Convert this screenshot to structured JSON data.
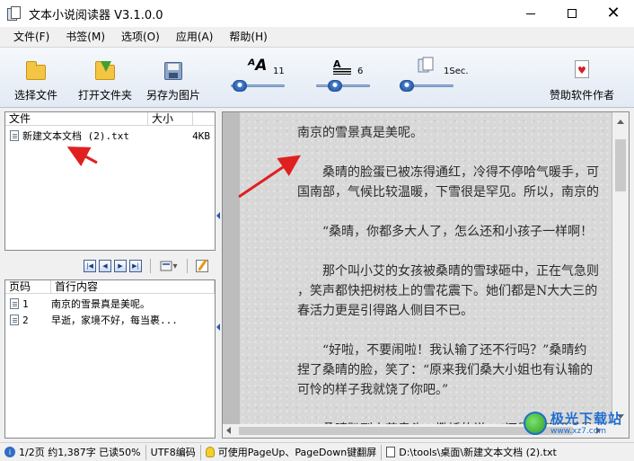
{
  "window": {
    "title": "文本小说阅读器 V3.1.0.0",
    "minimize_glyph": "",
    "close_glyph": "✕"
  },
  "menu": [
    "文件(F)",
    "书签(M)",
    "选项(O)",
    "应用(A)",
    "帮助(H)"
  ],
  "toolbar": {
    "select_file": "选择文件",
    "open_folder": "打开文件夹",
    "save_as_image": "另存为图片",
    "font_size_value": "11",
    "line_spacing_value": "6",
    "interval_value": "1Sec.",
    "sponsor": "赞助软件作者",
    "font_size_level": 0.05,
    "line_spacing_level": 0.3,
    "interval_level": 0.0
  },
  "file_list": {
    "col_file": "文件",
    "col_size": "大小",
    "rows": [
      {
        "name": "新建文本文档 (2).txt",
        "size": "4KB"
      }
    ]
  },
  "nav": {
    "first": "|◀",
    "prev": "◀",
    "next": "▶",
    "last": "▶|",
    "bookmark_dropdown": "▾"
  },
  "page_list": {
    "col_page": "页码",
    "col_first_line": "首行内容",
    "rows": [
      {
        "page": "1",
        "text": "南京的雪景真是美呢。"
      },
      {
        "page": "2",
        "text": "早逝，家境不好，每当裹..."
      }
    ]
  },
  "reader": {
    "lines": [
      "南京的雪景真是美呢。",
      "",
      "　　桑晴的脸蛋已被冻得通红，冷得不停哈气暖手，可",
      "国南部，气候比较温暖，下雪很是罕见。所以，南京的",
      "",
      "　　“桑晴，你都多大人了，怎么还和小孩子一样啊！",
      "",
      "　　那个叫小艾的女孩被桑晴的雪球砸中，正在气急则",
      "，笑声都快把树枝上的雪花震下。她们都是N大大三的",
      "春活力更是引得路人侧目不已。",
      "",
      "　　“好啦，不要闹啦！我认输了还不行吗？”桑晴约",
      "捏了桑晴的脸，笑了：“原来我们桑大小姐也有认输的",
      "可怜的样子我就饶了你吧。”",
      "",
      "　　桑晴趴到小艾肩头，撒娇的说：“还是小艾姐姐最"
    ]
  },
  "watermark": {
    "title": "极光下载站",
    "sub": "www.xz7.com"
  },
  "status": {
    "progress": "1/2页 约1,387字 已读50%",
    "encoding": "UTF8编码",
    "hint": "可使用PageUp、PageDown键翻屏",
    "path": "D:\\tools\\桌面\\新建文本文档 (2).txt"
  },
  "colors": {
    "annotation_arrow": "#e02020",
    "accent": "#2a5aa8"
  }
}
